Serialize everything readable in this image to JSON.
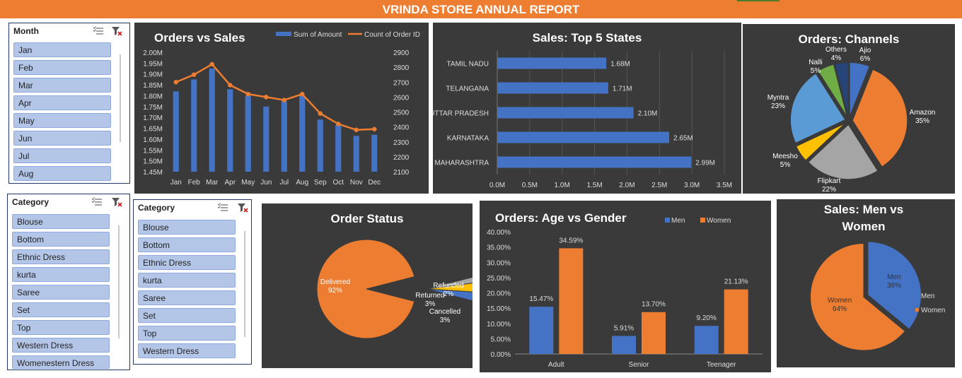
{
  "report_title": "VRINDA STORE ANNUAL REPORT",
  "colors": {
    "orange": "#ed7d31",
    "blue": "#4472c4",
    "gray": "#a5a5a5",
    "yellow": "#ffc000",
    "lightblue": "#5b9bd5",
    "green": "#70ad47"
  },
  "slicer_month": {
    "header": "Month",
    "items": [
      "Jan",
      "Feb",
      "Mar",
      "Apr",
      "May",
      "Jun",
      "Jul",
      "Aug"
    ]
  },
  "slicer_category_1": {
    "header": "Category",
    "items": [
      "Blouse",
      "Bottom",
      "Ethnic Dress",
      "kurta",
      "Saree",
      "Set",
      "Top",
      "Western Dress",
      "Womenestern Dress"
    ]
  },
  "slicer_category_2": {
    "header": "Category",
    "items": [
      "Blouse",
      "Bottom",
      "Ethnic Dress",
      "kurta",
      "Saree",
      "Set",
      "Top",
      "Western Dress"
    ]
  },
  "chart_data": [
    {
      "id": "orders_vs_sales",
      "type": "bar",
      "title": "Orders vs Sales",
      "categories": [
        "Jan",
        "Feb",
        "Mar",
        "Apr",
        "May",
        "Jun",
        "Jul",
        "Aug",
        "Sep",
        "Oct",
        "Nov",
        "Dec"
      ],
      "series": [
        {
          "name": "Sum of Amount",
          "type": "bar",
          "axis": "left",
          "values": [
            1.82,
            1.875,
            1.925,
            1.83,
            1.8,
            1.75,
            1.775,
            1.8,
            1.69,
            1.665,
            1.615,
            1.62
          ]
        },
        {
          "name": "Count of Order ID",
          "type": "line",
          "axis": "right",
          "values": [
            2700,
            2750,
            2820,
            2680,
            2620,
            2600,
            2580,
            2620,
            2490,
            2420,
            2380,
            2385
          ]
        }
      ],
      "y_left": {
        "ticks": [
          "2.00M",
          "1.95M",
          "1.90M",
          "1.85M",
          "1.80M",
          "1.75M",
          "1.70M",
          "1.65M",
          "1.60M",
          "1.55M",
          "1.50M",
          "1.45M"
        ],
        "ylim": [
          1.45,
          2.0
        ]
      },
      "y_right": {
        "ticks": [
          "2900",
          "2800",
          "2700",
          "2600",
          "2500",
          "2400",
          "2300",
          "2200",
          "2100"
        ],
        "ylim": [
          2100,
          2900
        ]
      },
      "legend": "top-right"
    },
    {
      "id": "top5_states",
      "type": "bar",
      "orientation": "horizontal",
      "title": "Sales: Top 5 States",
      "categories": [
        "TAMIL NADU",
        "TELANGANA",
        "UTTAR PRADESH",
        "KARNATAKA",
        "MAHARASHTRA"
      ],
      "values": [
        1.68,
        1.71,
        2.1,
        2.65,
        2.99
      ],
      "data_labels": [
        "1.68M",
        "1.71M",
        "2.10M",
        "2.65M",
        "2.99M"
      ],
      "x_ticks": [
        "0.0M",
        "0.5M",
        "1.0M",
        "1.5M",
        "2.0M",
        "2.5M",
        "3.0M",
        "3.5M"
      ],
      "xlim": [
        0,
        3.5
      ]
    },
    {
      "id": "orders_channels",
      "type": "pie",
      "title": "Orders: Channels",
      "slices": [
        {
          "label": "Ajio",
          "value": 6,
          "text": "6%",
          "color": "#4472c4"
        },
        {
          "label": "Amazon",
          "value": 35,
          "text": "35%",
          "color": "#ed7d31"
        },
        {
          "label": "Flipkart",
          "value": 22,
          "text": "22%",
          "color": "#a5a5a5"
        },
        {
          "label": "Meesho",
          "value": 5,
          "text": "5%",
          "color": "#ffc000"
        },
        {
          "label": "Myntra",
          "value": 23,
          "text": "23%",
          "color": "#5b9bd5"
        },
        {
          "label": "Nalli",
          "value": 5,
          "text": "5%",
          "color": "#70ad47"
        },
        {
          "label": "Others",
          "value": 4,
          "text": "4%",
          "color": "#264478"
        }
      ]
    },
    {
      "id": "order_status",
      "type": "pie",
      "title": "Order Status",
      "slices": [
        {
          "label": "Delivered",
          "value": 92,
          "text": "92%",
          "color": "#ed7d31"
        },
        {
          "label": "Refunded",
          "value": 2,
          "text": "2%",
          "color": "#a5a5a5"
        },
        {
          "label": "Returned",
          "value": 3,
          "text": "3%",
          "color": "#ffc000"
        },
        {
          "label": "Cancelled",
          "value": 3,
          "text": "3%",
          "color": "#4472c4"
        }
      ]
    },
    {
      "id": "age_vs_gender",
      "type": "bar",
      "title": "Orders: Age vs Gender",
      "categories": [
        "Adult",
        "Senior",
        "Teenager"
      ],
      "series": [
        {
          "name": "Men",
          "values": [
            15.47,
            5.91,
            9.2
          ],
          "labels": [
            "15.47%",
            "5.91%",
            "9.20%"
          ],
          "color": "#4472c4"
        },
        {
          "name": "Women",
          "values": [
            34.59,
            13.7,
            21.13
          ],
          "labels": [
            "34.59%",
            "13.70%",
            "21.13%"
          ],
          "color": "#ed7d31"
        }
      ],
      "y_ticks": [
        "40.00%",
        "35.00%",
        "30.00%",
        "25.00%",
        "20.00%",
        "15.00%",
        "10.00%",
        "5.00%",
        "0.00%"
      ],
      "ylim": [
        0,
        40
      ],
      "legend": "top-right"
    },
    {
      "id": "sales_men_women",
      "type": "pie",
      "title": "Sales: Men vs Women",
      "slices": [
        {
          "label": "Men",
          "value": 36,
          "text": "36%",
          "color": "#4472c4"
        },
        {
          "label": "Women",
          "value": 64,
          "text": "64%",
          "color": "#ed7d31"
        }
      ],
      "legend_items": [
        "Men",
        "Women"
      ],
      "legend": "right"
    }
  ]
}
